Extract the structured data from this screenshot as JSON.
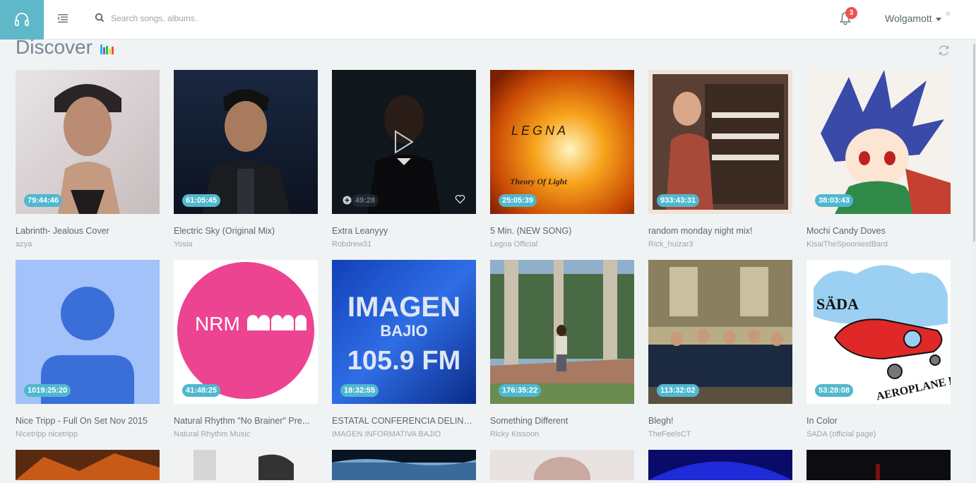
{
  "app": {
    "logo": "headphones-icon"
  },
  "search": {
    "placeholder": "Search songs, albums..."
  },
  "notifications": {
    "count": "3"
  },
  "user": {
    "name": "Wolgamott"
  },
  "page": {
    "title": "Discover"
  },
  "colors": {
    "accent": "#5fb8c7",
    "badge": "#f05050",
    "duration_pill": "#4fb8cf",
    "background": "#f0f3f4"
  },
  "tracks_row1": [
    {
      "title": "Labrinth- Jealous Cover",
      "artist": "azya",
      "duration": "79:44:46"
    },
    {
      "title": "Electric Sky (Original Mix)",
      "artist": "Yosia",
      "duration": "61:05:45"
    },
    {
      "title": "Extra Leanyyy",
      "artist": "Robdrew31",
      "duration": "49:28"
    },
    {
      "title": "5 Min. (NEW SONG)",
      "artist": "Legna Official",
      "duration": "25:05:39",
      "art_text": "LEGNA",
      "art_subtext": "Theory Of Light"
    },
    {
      "title": "random monday night mix!",
      "artist": "Rick_huizar3",
      "duration": "933:43:31"
    },
    {
      "title": "Mochi Candy Doves",
      "artist": "KisaiTheSpooniestBard",
      "duration": "38:03:43"
    }
  ],
  "tracks_row2": [
    {
      "title": "Nice Tripp - Full On Set Nov 2015",
      "artist": "Nicetripp nicetripp",
      "duration": "1019:25:20"
    },
    {
      "title": "Natural Rhythm \"No Brainer\" Pre...",
      "artist": "Natural Rhythm Music",
      "duration": "41:48:25",
      "art_text": "NRM"
    },
    {
      "title": "ESTATAL CONFERENCIA DELINC...",
      "artist": "IMAGEN INFORMATIVA BAJIO",
      "duration": "18:32:55",
      "art_text": "IMAGEN",
      "art_subtext": "BAJIO",
      "art_subtext2": "105.9 FM"
    },
    {
      "title": "Something Different",
      "artist": "Ricky Kissoon",
      "duration": "176:35:22"
    },
    {
      "title": "Blegh!",
      "artist": "TheFeelsCT",
      "duration": "113:32:02"
    },
    {
      "title": "In Color",
      "artist": "SADA (official page)",
      "duration": "53:28:08",
      "art_text": "SÄDA",
      "art_subtext": "AEROPLANE EP"
    }
  ]
}
